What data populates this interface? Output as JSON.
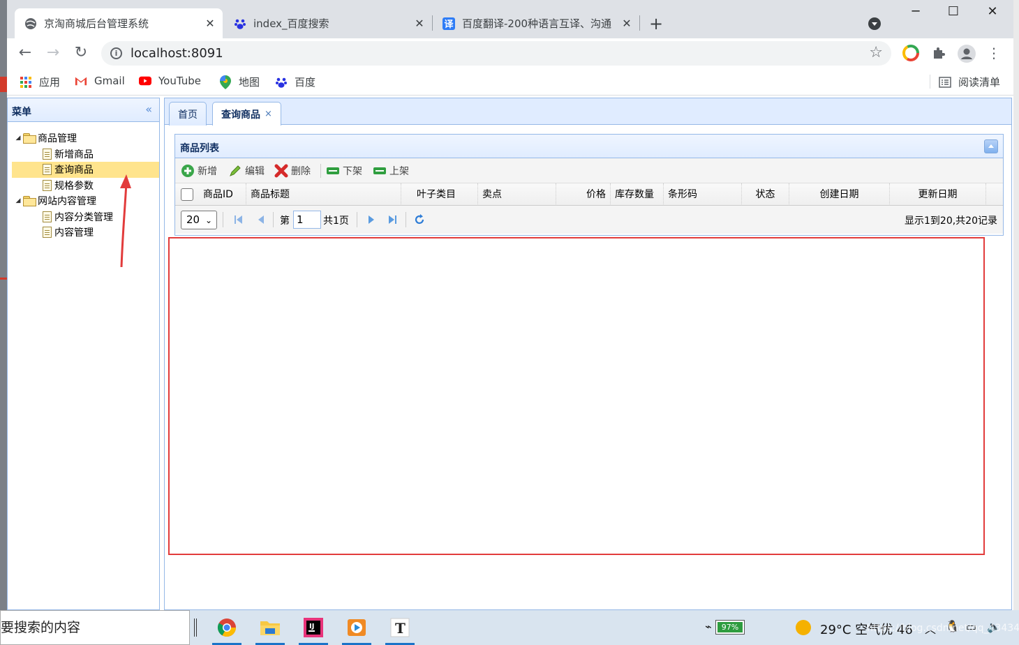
{
  "browser": {
    "tabs": [
      {
        "title": "京淘商城后台管理系统",
        "active": true
      },
      {
        "title": "index_百度搜索",
        "active": false
      },
      {
        "title": "百度翻译-200种语言互译、沟通",
        "active": false
      }
    ],
    "new_tab_icon": "plus-icon",
    "tab_close": "✕",
    "url": "localhost:8091",
    "window_controls": {
      "minimize": "─",
      "maximize": "☐",
      "close": "✕"
    }
  },
  "bookmarks": {
    "items": [
      {
        "label": "应用",
        "icon": "apps-grid-icon"
      },
      {
        "label": "Gmail",
        "icon": "gmail-icon"
      },
      {
        "label": "YouTube",
        "icon": "youtube-icon"
      },
      {
        "label": "地图",
        "icon": "maps-pin-icon"
      },
      {
        "label": "百度",
        "icon": "baidu-paw-icon"
      }
    ],
    "reading_list": "阅读清单"
  },
  "menu": {
    "title": "菜单",
    "tree": [
      {
        "label": "商品管理",
        "type": "folder"
      },
      {
        "label": "新增商品",
        "type": "file"
      },
      {
        "label": "查询商品",
        "type": "file",
        "selected": true
      },
      {
        "label": "规格参数",
        "type": "file"
      },
      {
        "label": "网站内容管理",
        "type": "folder"
      },
      {
        "label": "内容分类管理",
        "type": "file"
      },
      {
        "label": "内容管理",
        "type": "file"
      }
    ]
  },
  "content_tabs": [
    {
      "label": "首页"
    },
    {
      "label": "查询商品",
      "active": true,
      "close": "×"
    }
  ],
  "grid": {
    "title": "商品列表",
    "toolbar": [
      {
        "label": "新增",
        "icon": "add-icon"
      },
      {
        "label": "编辑",
        "icon": "edit-pencil-icon"
      },
      {
        "label": "删除",
        "icon": "delete-x-icon"
      },
      {
        "label": "下架",
        "icon": "shelf-down-icon"
      },
      {
        "label": "上架",
        "icon": "shelf-up-icon"
      }
    ],
    "columns": [
      "商品ID",
      "商品标题",
      "叶子类目",
      "卖点",
      "价格",
      "库存数量",
      "条形码",
      "状态",
      "创建日期",
      "更新日期"
    ],
    "pager": {
      "page_size": "20",
      "page_prefix": "第",
      "page_value": "1",
      "page_total": "共1页",
      "info": "显示1到20,共20记录"
    }
  },
  "taskbar": {
    "search_text": "要搜索的内容",
    "battery": "97%",
    "weather": "29°C  空气优 46",
    "watermark": "https://blog.csdn.net/qq_43434"
  },
  "colors": {
    "accent_border": "#95b8e7",
    "selected_node": "#ffe48d",
    "annotation_red": "#e23b3b"
  }
}
